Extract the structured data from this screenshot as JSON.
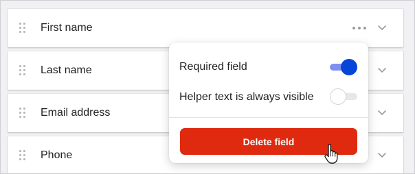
{
  "fields": [
    {
      "label": "First name"
    },
    {
      "label": "Last name"
    },
    {
      "label": "Email address"
    },
    {
      "label": "Phone"
    }
  ],
  "popover": {
    "required_label": "Required field",
    "required_on": true,
    "helper_label": "Helper text is always visible",
    "helper_on": false,
    "delete_label": "Delete field"
  },
  "colors": {
    "toggle_on": "#0645d8",
    "delete_button": "#df2a0f"
  },
  "icons": {
    "drag": "drag-handle-icon",
    "more": "more-horizontal-icon",
    "expand": "chevron-down-icon",
    "cursor": "hand-pointer-cursor-icon"
  }
}
